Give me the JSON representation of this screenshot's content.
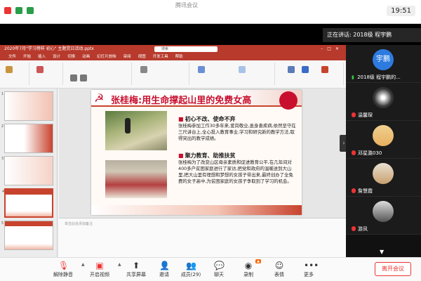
{
  "meeting": {
    "top_title": "腾讯会议",
    "clock": "19:51",
    "speaking_prefix": "正在讲话:",
    "speaking_name": "2018级 程宇鹏"
  },
  "ppt": {
    "window_title": "2020年7月\"学习榜样 初心\" 主题党日活动.pptx",
    "search_placeholder": "搜索",
    "tabs": [
      "文件",
      "开始",
      "插入",
      "设计",
      "切换",
      "动画",
      "幻灯片放映",
      "审阅",
      "视图",
      "开发工具",
      "帮助"
    ],
    "notes_placeholder": "单击此处添加备注"
  },
  "thumbnails": [
    {
      "num": "1",
      "text": "学习榜样 初心"
    },
    {
      "num": "2",
      "text": "目录"
    },
    {
      "num": "3",
      "text": "学习榜样"
    },
    {
      "num": "4",
      "text": "张桂梅"
    },
    {
      "num": "5",
      "text": "张桂梅"
    }
  ],
  "slide": {
    "title": "张桂梅:用生命撑起山里的免费女高",
    "section1_heading": "初心不改、使命不弃",
    "section1_text": "张桂梅参加工作30多年来,爱岗敬业,虽身患疾病,依然坚守在三尺讲台上,全心投入教育事业,学习和研究新的教学方法,取得突出的教学成绩。",
    "section2_heading": "聚力教育、助推扶贫",
    "section2_text": "张桂梅为了改变山区母亲素质和促进教育公平,在几年间对400多户贫困家庭进行了家访,把党和政府的温暖送到大山里,把大山里有理想和梦想的女孩子带出来,最终创办了全免费的女子高中,为贫困家庭的女孩子争取到了学习的机会。"
  },
  "participants": [
    {
      "name": "2018级 程宇鹏的...",
      "avatar_text": "宇鹏",
      "muted": false
    },
    {
      "name": "温馨琛",
      "avatar_text": "",
      "muted": true
    },
    {
      "name": "邓星潞030",
      "avatar_text": "",
      "muted": true
    },
    {
      "name": "詹慧霞",
      "avatar_text": "",
      "muted": true
    },
    {
      "name": "游凤",
      "avatar_text": "",
      "muted": true
    }
  ],
  "toolbar": {
    "mute": "解除静音",
    "video": "开启视频",
    "share": "共享屏幕",
    "invite": "邀请",
    "members": "成员(29)",
    "chat": "聊天",
    "record": "录制",
    "emoji": "表情",
    "more": "更多",
    "end": "离开会议"
  },
  "colors": {
    "ppt_accent": "#b73a2c",
    "slide_red": "#c8102e",
    "end_red": "#e33333"
  }
}
